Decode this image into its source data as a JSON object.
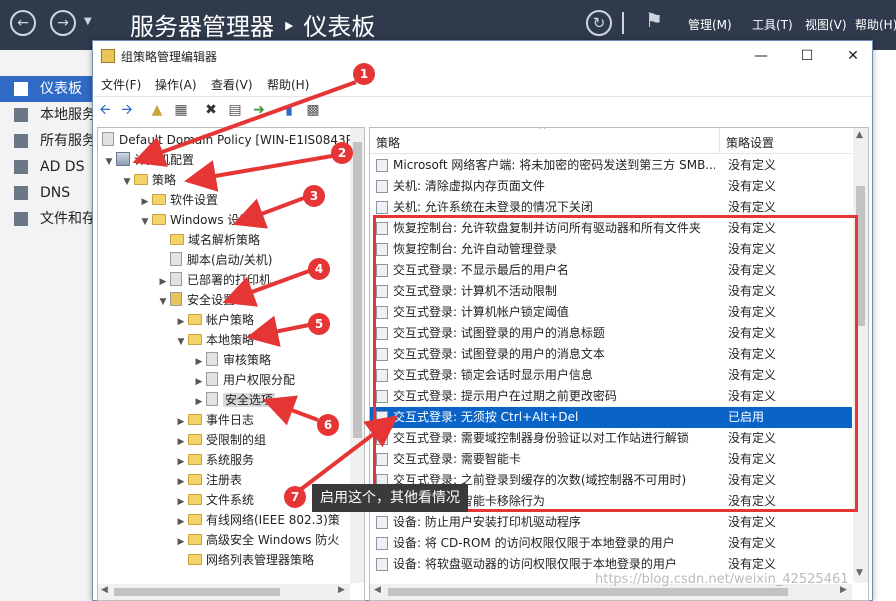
{
  "server_manager": {
    "title": "服务器管理器 ‣ 仪表板",
    "menus": [
      "管理(M)",
      "工具(T)",
      "视图(V)",
      "帮助(H)"
    ],
    "sidebar": [
      {
        "label": "仪表板",
        "active": true
      },
      {
        "label": "本地服务",
        "active": false
      },
      {
        "label": "所有服务",
        "active": false
      },
      {
        "label": "AD DS",
        "active": false
      },
      {
        "label": "DNS",
        "active": false
      },
      {
        "label": "文件和存",
        "active": false
      }
    ]
  },
  "gpo_window": {
    "title": "组策略管理编辑器",
    "menu": [
      "文件(F)",
      "操作(A)",
      "查看(V)",
      "帮助(H)"
    ],
    "tree": [
      {
        "label": "Default Domain Policy [WIN-E1IS0843P",
        "icon": "gpo"
      },
      {
        "label": "计算机配置",
        "icon": "computer"
      },
      {
        "label": "策略",
        "icon": "folder"
      },
      {
        "label": "软件设置",
        "icon": "folder"
      },
      {
        "label": "Windows 设置",
        "icon": "folder"
      },
      {
        "label": "域名解析策略",
        "icon": "folder"
      },
      {
        "label": "脚本(启动/关机)",
        "icon": "script"
      },
      {
        "label": "已部署的打印机",
        "icon": "printer"
      },
      {
        "label": "安全设置",
        "icon": "security"
      },
      {
        "label": "帐户策略",
        "icon": "folder"
      },
      {
        "label": "本地策略",
        "icon": "folder"
      },
      {
        "label": "审核策略",
        "icon": "folder"
      },
      {
        "label": "用户权限分配",
        "icon": "folder"
      },
      {
        "label": "安全选项",
        "icon": "folder"
      },
      {
        "label": "事件日志",
        "icon": "folder"
      },
      {
        "label": "受限制的组",
        "icon": "folder"
      },
      {
        "label": "系统服务",
        "icon": "folder"
      },
      {
        "label": "注册表",
        "icon": "folder"
      },
      {
        "label": "文件系统",
        "icon": "folder"
      },
      {
        "label": "有线网络(IEEE 802.3)策",
        "icon": "folder"
      },
      {
        "label": "高级安全 Windows 防火",
        "icon": "folder"
      },
      {
        "label": "网络列表管理器策略",
        "icon": "folder"
      }
    ],
    "list_headers": {
      "policy": "策略",
      "setting": "策略设置"
    },
    "policies": [
      {
        "name": "Microsoft 网络客户端: 将未加密的密码发送到第三方 SMB...",
        "setting": "没有定义"
      },
      {
        "name": "关机: 清除虚拟内存页面文件",
        "setting": "没有定义"
      },
      {
        "name": "关机: 允许系统在未登录的情况下关闭",
        "setting": "没有定义"
      },
      {
        "name": "恢复控制台: 允许软盘复制并访问所有驱动器和所有文件夹",
        "setting": "没有定义"
      },
      {
        "name": "恢复控制台: 允许自动管理登录",
        "setting": "没有定义"
      },
      {
        "name": "交互式登录: 不显示最后的用户名",
        "setting": "没有定义"
      },
      {
        "name": "交互式登录: 计算机不活动限制",
        "setting": "没有定义"
      },
      {
        "name": "交互式登录: 计算机帐户锁定阈值",
        "setting": "没有定义"
      },
      {
        "name": "交互式登录: 试图登录的用户的消息标题",
        "setting": "没有定义"
      },
      {
        "name": "交互式登录: 试图登录的用户的消息文本",
        "setting": "没有定义"
      },
      {
        "name": "交互式登录: 锁定会话时显示用户信息",
        "setting": "没有定义"
      },
      {
        "name": "交互式登录: 提示用户在过期之前更改密码",
        "setting": "没有定义"
      },
      {
        "name": "交互式登录: 无须按 Ctrl+Alt+Del",
        "setting": "已启用",
        "selected": true
      },
      {
        "name": "交互式登录: 需要域控制器身份验证以对工作站进行解锁",
        "setting": "没有定义"
      },
      {
        "name": "交互式登录: 需要智能卡",
        "setting": "没有定义"
      },
      {
        "name": "交互式登录: 之前登录到缓存的次数(域控制器不可用时)",
        "setting": "没有定义"
      },
      {
        "name": "交互式登录: 智能卡移除行为",
        "setting": "没有定义"
      },
      {
        "name": "设备: 防止用户安装打印机驱动程序",
        "setting": "没有定义"
      },
      {
        "name": "设备: 将 CD-ROM 的访问权限仅限于本地登录的用户",
        "setting": "没有定义"
      },
      {
        "name": "设备: 将软盘驱动器的访问权限仅限于本地登录的用户",
        "setting": "没有定义"
      }
    ]
  },
  "annotations": {
    "badges": [
      "1",
      "2",
      "3",
      "4",
      "5",
      "6",
      "7"
    ],
    "note": "启用这个，其他看情况",
    "color": "#e53535"
  },
  "watermark": "https://blog.csdn.net/weixin_42525461"
}
